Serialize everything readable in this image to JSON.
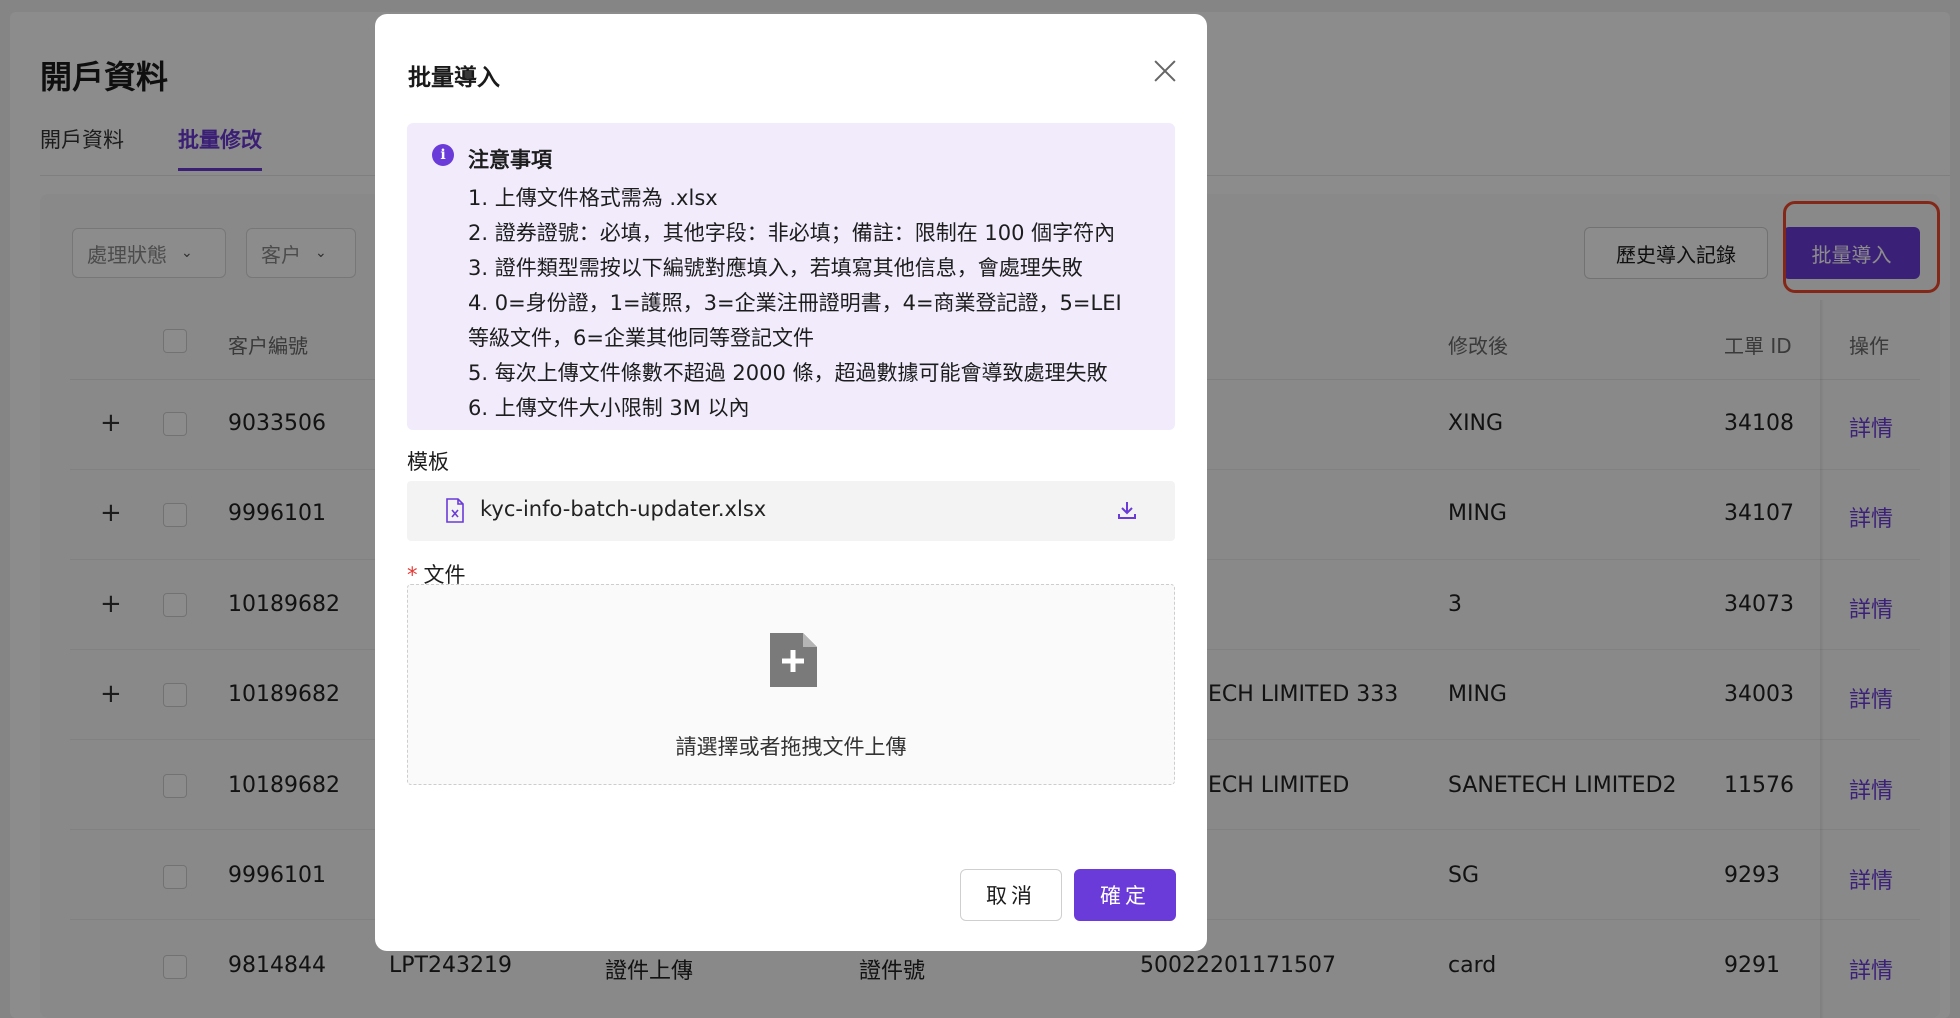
{
  "page": {
    "title": "開戶資料",
    "tabs": [
      {
        "label": "開戶資料"
      },
      {
        "label": "批量修改"
      }
    ],
    "filters": [
      {
        "placeholder": "處理狀態"
      },
      {
        "placeholder": "客户"
      }
    ],
    "history_button": "歷史導入記錄",
    "import_button": "批量導入",
    "columns": [
      "客户編號",
      "修改後",
      "工單 ID",
      "操作"
    ],
    "rows": [
      {
        "customer_id": "9033506",
        "col3": "",
        "col4": "",
        "col5": "",
        "after": "XING",
        "ticket": "34108",
        "action": "詳情",
        "expandable": "+"
      },
      {
        "customer_id": "9996101",
        "col3": "",
        "col4": "",
        "col5": "",
        "after": "MING",
        "ticket": "34107",
        "action": "詳情",
        "expandable": "+"
      },
      {
        "customer_id": "10189682",
        "col3": "",
        "col4": "",
        "col5": "",
        "after": "3",
        "ticket": "34073",
        "action": "詳情",
        "expandable": "+"
      },
      {
        "customer_id": "10189682",
        "col3": "",
        "col4": "",
        "col5": "ECH LIMITED 333",
        "after": "MING",
        "ticket": "34003",
        "action": "詳情",
        "expandable": "+"
      },
      {
        "customer_id": "10189682",
        "col3": "",
        "col4": "",
        "col5": "ECH LIMITED",
        "after": "SANETECH LIMITED2",
        "ticket": "11576",
        "action": "詳情",
        "expandable": ""
      },
      {
        "customer_id": "9996101",
        "col3": "",
        "col4": "",
        "col5": "",
        "after": "SG",
        "ticket": "9293",
        "action": "詳情",
        "expandable": ""
      },
      {
        "customer_id": "9814844",
        "col3": "LPT243219",
        "col4": "證件上傳",
        "col4b": "證件號",
        "col5": "50022201171507",
        "after": "card",
        "ticket": "9291",
        "action": "詳情",
        "expandable": ""
      }
    ]
  },
  "modal": {
    "title": "批量導入",
    "notice_title": "注意事項",
    "notice_lines": [
      "1. 上傳文件格式需為 .xlsx",
      "2. 證券證號：必填，其他字段：非必填；備註：限制在 100 個字符內",
      "3. 證件類型需按以下編號對應填入，若填寫其他信息，會處理失敗",
      "4. 0=身份證，1=護照，3=企業注冊證明書，4=商業登記證，5=LEI",
      "等級文件，6=企業其他同等登記文件",
      "5. 每次上傳文件條數不超過 2000 條，超過數據可能會導致處理失敗",
      "6. 上傳文件大小限制 3M 以內"
    ],
    "template_label": "模板",
    "template_file": "kyc-info-batch-updater.xlsx",
    "file_label": "文件",
    "required_mark": "*",
    "dropzone_text": "請選擇或者拖拽文件上傳",
    "cancel_label": "取消",
    "ok_label": "確定"
  },
  "colors": {
    "accent": "#6a3bd9",
    "notice_bg": "#f1ebfc",
    "highlight": "#ee4a2f"
  },
  "icons": [
    "info-icon",
    "close-icon",
    "excel-file-icon",
    "download-icon",
    "upload-file-icon",
    "chevron-down-icon",
    "expand-plus-icon"
  ]
}
